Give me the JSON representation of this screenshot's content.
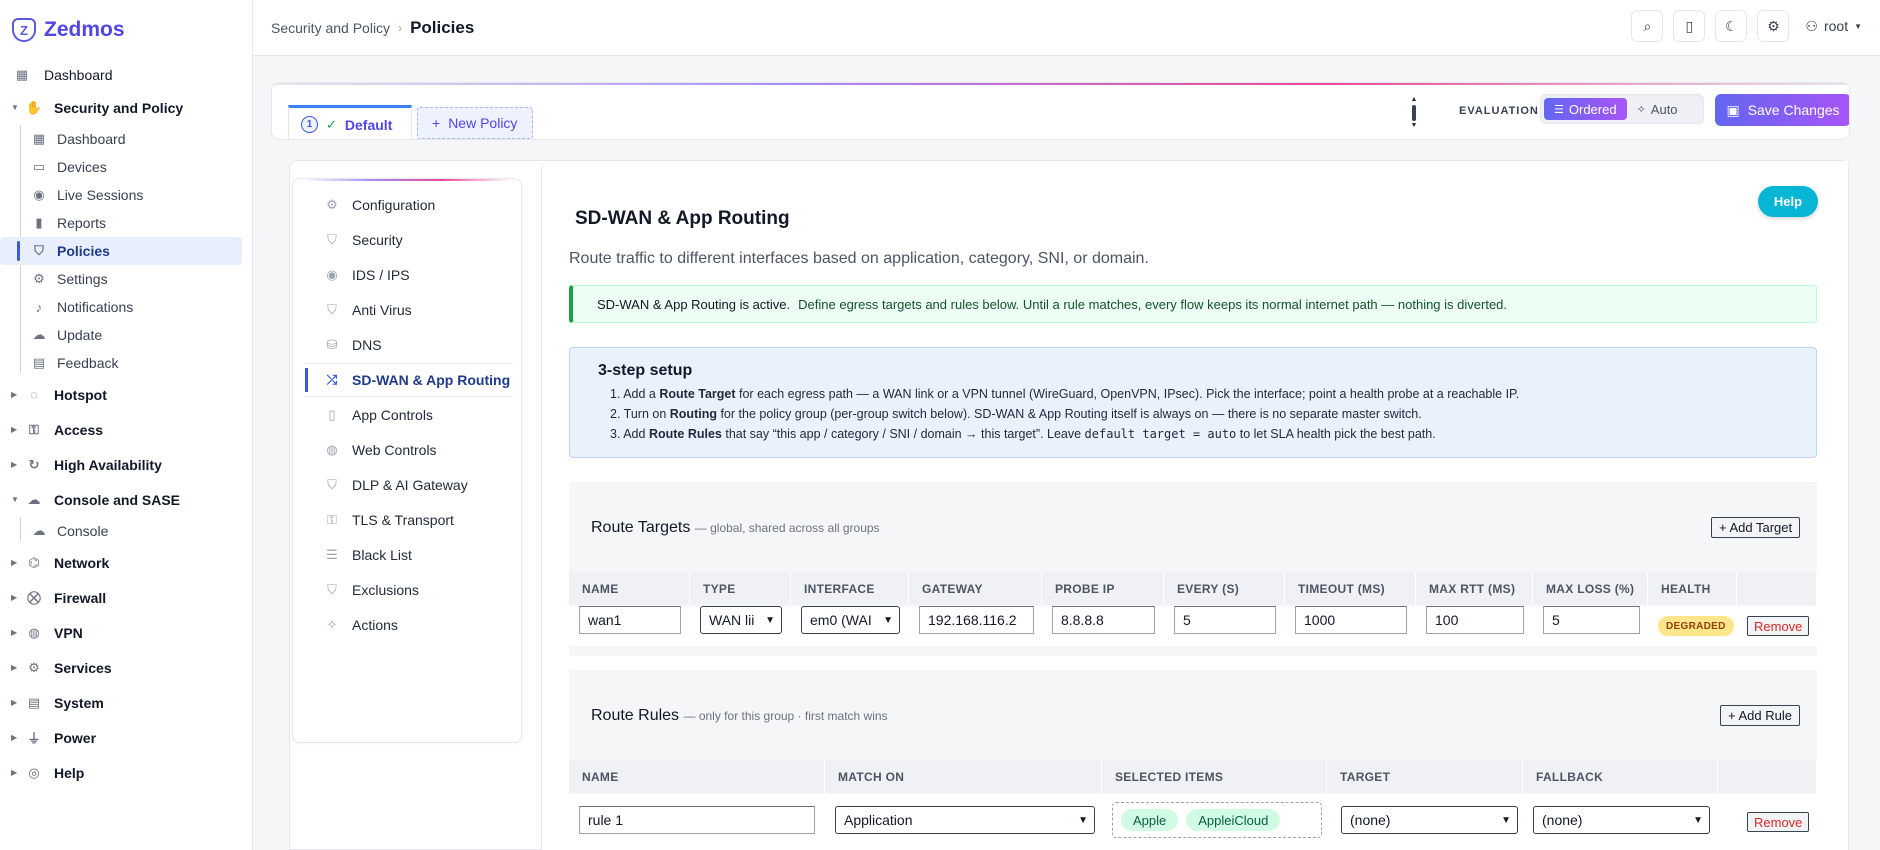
{
  "brand": {
    "name": "Zedmos",
    "logo_letter": "Z"
  },
  "sidebar": {
    "dashboard": "Dashboard",
    "security_group": "Security and Policy",
    "security_items": [
      {
        "label": "Dashboard",
        "icon": "grid-icon"
      },
      {
        "label": "Devices",
        "icon": "monitor-icon"
      },
      {
        "label": "Live Sessions",
        "icon": "eye-icon"
      },
      {
        "label": "Reports",
        "icon": "bar-chart-icon"
      },
      {
        "label": "Policies",
        "icon": "shield-icon",
        "active": true
      },
      {
        "label": "Settings",
        "icon": "gear-icon"
      },
      {
        "label": "Notifications",
        "icon": "bell-icon"
      },
      {
        "label": "Update",
        "icon": "cloud-download-icon"
      },
      {
        "label": "Feedback",
        "icon": "feedback-icon"
      }
    ],
    "groups_a": [
      {
        "label": "Hotspot",
        "icon": "wifi-icon"
      },
      {
        "label": "Access",
        "icon": "access-icon"
      },
      {
        "label": "High Availability",
        "icon": "refresh-icon"
      }
    ],
    "console_group": "Console and SASE",
    "console_items": [
      {
        "label": "Console",
        "icon": "cloud-download-icon"
      }
    ],
    "groups_b": [
      {
        "label": "Network",
        "icon": "network-icon"
      },
      {
        "label": "Firewall",
        "icon": "firewall-icon"
      },
      {
        "label": "VPN",
        "icon": "globe-icon"
      },
      {
        "label": "Services",
        "icon": "gear-icon"
      },
      {
        "label": "System",
        "icon": "server-icon"
      },
      {
        "label": "Power",
        "icon": "plug-icon"
      },
      {
        "label": "Help",
        "icon": "lifebuoy-icon"
      }
    ]
  },
  "topbar": {
    "crumb_parent": "Security and Policy",
    "crumb_current": "Policies",
    "user": "root"
  },
  "policy": {
    "tabs": {
      "default_num": "1",
      "default_label": "Default",
      "new_label": "New Policy"
    },
    "evaluation_label": "EVALUATION",
    "eval_ordered": "Ordered",
    "eval_auto": "Auto",
    "save_label": "Save Changes"
  },
  "inner_nav": [
    {
      "label": "Configuration",
      "icon": "gear-icon"
    },
    {
      "label": "Security",
      "icon": "shield-icon"
    },
    {
      "label": "IDS / IPS",
      "icon": "eye-icon"
    },
    {
      "label": "Anti Virus",
      "icon": "shield-icon"
    },
    {
      "label": "DNS",
      "icon": "database-icon"
    },
    {
      "label": "SD-WAN & App Routing",
      "icon": "shuffle-icon",
      "active": true
    },
    {
      "label": "App Controls",
      "icon": "mobile-icon"
    },
    {
      "label": "Web Controls",
      "icon": "globe-icon"
    },
    {
      "label": "DLP & AI Gateway",
      "icon": "shield-icon"
    },
    {
      "label": "TLS & Transport",
      "icon": "lock-icon"
    },
    {
      "label": "Black List",
      "icon": "list-icon"
    },
    {
      "label": "Exclusions",
      "icon": "shield-icon"
    },
    {
      "label": "Actions",
      "icon": "wand-icon"
    }
  ],
  "panel": {
    "help": "Help",
    "title": "SD-WAN & App Routing",
    "description": "Route traffic to different interfaces based on application, category, SNI, or domain.",
    "banner_strong": "SD-WAN & App Routing is active.",
    "banner_text": "Define egress targets and rules below. Until a rule matches, every flow keeps its normal internet path — nothing is diverted.",
    "setup": {
      "title": "3-step setup",
      "s1_a": "1. Add a ",
      "s1_b": "Route Target",
      "s1_c": " for each egress path — a WAN link or a VPN tunnel (WireGuard, OpenVPN, IPsec). Pick the interface; point a health probe at a reachable IP.",
      "s2_a": "2. Turn on ",
      "s2_b": "Routing",
      "s2_c": " for the policy group (per-group switch below). SD-WAN & App Routing itself is always on — there is no separate master switch.",
      "s3_a": "3. Add ",
      "s3_b": "Route Rules",
      "s3_c": " that say “this app / category / SNI / domain → this target”. Leave ",
      "s3_code": "default target = auto",
      "s3_d": " to let SLA health pick the best path."
    }
  },
  "targets": {
    "title": "Route Targets",
    "subtitle": "— global, shared across all groups",
    "add": "+ Add Target",
    "columns": [
      "NAME",
      "TYPE",
      "INTERFACE",
      "GATEWAY",
      "PROBE IP",
      "EVERY (S)",
      "TIMEOUT (MS)",
      "MAX RTT (MS)",
      "MAX LOSS (%)",
      "HEALTH",
      ""
    ],
    "row": {
      "name": "wan1",
      "type": "WAN lii",
      "interface": "em0 (WAI",
      "gateway": "192.168.116.2",
      "probe": "8.8.8.8",
      "every": "5",
      "timeout": "1000",
      "rtt": "100",
      "loss": "5",
      "health": "DEGRADED",
      "remove": "Remove"
    }
  },
  "rules": {
    "title": "Route Rules",
    "subtitle": "— only for this group · first match wins",
    "add": "+ Add Rule",
    "columns": [
      "NAME",
      "MATCH ON",
      "SELECTED ITEMS",
      "TARGET",
      "FALLBACK",
      ""
    ],
    "row": {
      "name": "rule 1",
      "match": "Application",
      "items": [
        "Apple",
        "AppleiCloud"
      ],
      "target": "(none)",
      "fallback": "(none)",
      "remove": "Remove"
    }
  }
}
